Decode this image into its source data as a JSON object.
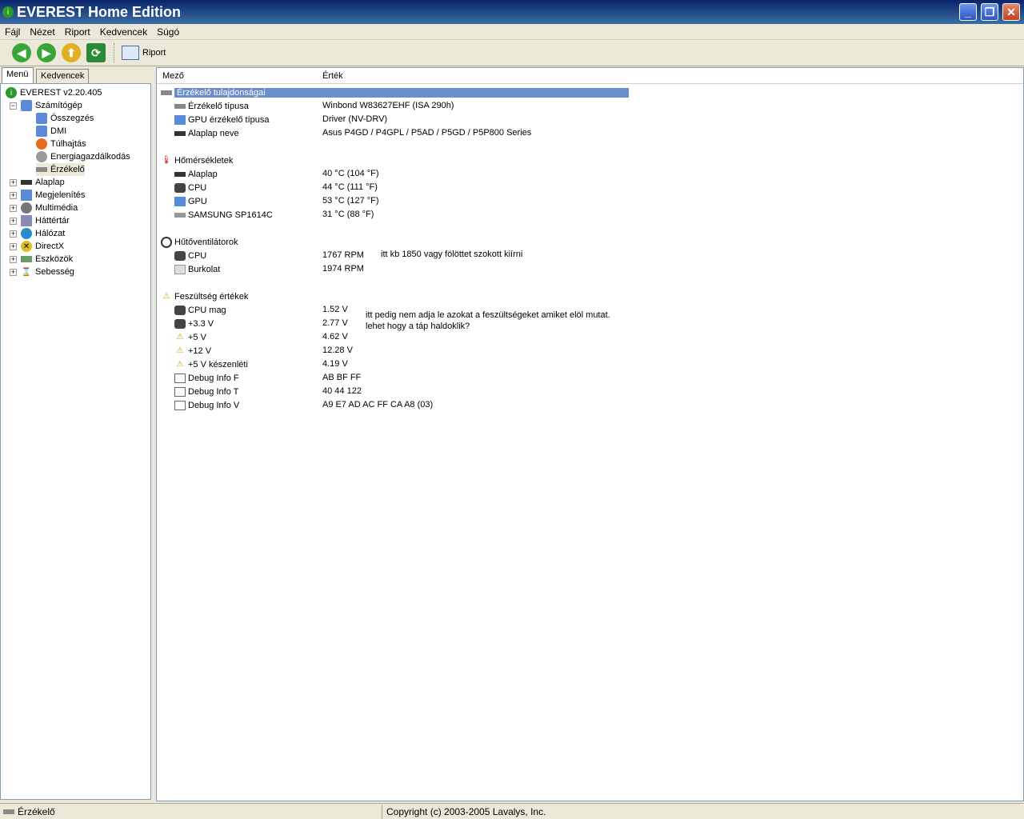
{
  "window": {
    "title": "EVEREST Home Edition"
  },
  "menu": [
    "Fájl",
    "Nézet",
    "Riport",
    "Kedvencek",
    "Súgó"
  ],
  "toolbar": {
    "report_label": "Riport"
  },
  "tabs": [
    "Menü",
    "Kedvencek"
  ],
  "tree": {
    "root": "EVEREST v2.20.405",
    "computer": "Számítógép",
    "children": [
      "Összegzés",
      "DMI",
      "Túlhajtás",
      "Energiagazdálkodás",
      "Érzékelő"
    ],
    "groups": [
      "Alaplap",
      "Megjelenítés",
      "Multimédia",
      "Háttértár",
      "Hálózat",
      "DirectX",
      "Eszközök",
      "Sebesség"
    ]
  },
  "columns": {
    "field": "Mező",
    "value": "Érték"
  },
  "sections": {
    "props": {
      "title": "Érzékelő tulajdonságai",
      "rows": [
        [
          "Érzékelő típusa",
          "Winbond W83627EHF  (ISA 290h)"
        ],
        [
          "GPU érzékelő típusa",
          "Driver  (NV-DRV)"
        ],
        [
          "Alaplap neve",
          "Asus P4GD / P4GPL / P5AD / P5GD / P5P800 Series"
        ]
      ]
    },
    "temps": {
      "title": "Hőmérsékletek",
      "rows": [
        [
          "Alaplap",
          "40 °C  (104 °F)"
        ],
        [
          "CPU",
          "44 °C  (111 °F)"
        ],
        [
          "GPU",
          "53 °C  (127 °F)"
        ],
        [
          "SAMSUNG SP1614C",
          "31 °C  (88 °F)"
        ]
      ]
    },
    "fans": {
      "title": "Hűtőventilátorok",
      "rows": [
        [
          "CPU",
          "1767 RPM"
        ],
        [
          "Burkolat",
          "1974 RPM"
        ]
      ]
    },
    "volts": {
      "title": "Feszültség értékek",
      "rows": [
        [
          "CPU mag",
          "1.52 V"
        ],
        [
          "+3.3 V",
          "2.77 V"
        ],
        [
          "+5 V",
          "4.62 V"
        ],
        [
          "+12 V",
          "12.28 V"
        ],
        [
          "+5 V készenléti",
          "4.19 V"
        ],
        [
          "Debug Info F",
          "AB BF FF"
        ],
        [
          "Debug Info T",
          "40 44 122"
        ],
        [
          "Debug Info V",
          "A9 E7 AD AC FF CA A8 (03)"
        ]
      ]
    }
  },
  "notes": {
    "fan": "itt kb 1850 vagy fölöttet szokott kiírni",
    "volt1": "itt pedig nem adja le  azokat a feszültségeket amiket elöl mutat.",
    "volt2": "lehet hogy a táp haldoklik?"
  },
  "status": {
    "left": "Érzékelő",
    "right": "Copyright (c) 2003-2005 Lavalys, Inc."
  }
}
